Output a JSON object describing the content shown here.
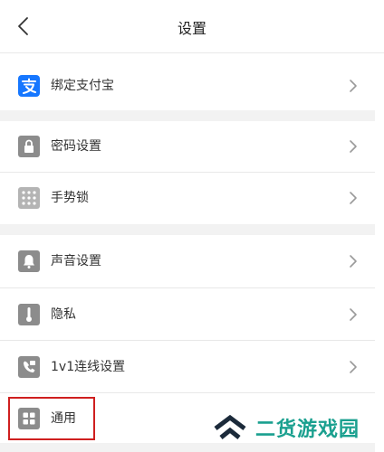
{
  "header": {
    "title": "设置"
  },
  "sections": [
    {
      "items": [
        {
          "label": "绑定支付宝",
          "icon": "alipay-icon"
        }
      ]
    },
    {
      "items": [
        {
          "label": "密码设置",
          "icon": "lock-icon"
        },
        {
          "label": "手势锁",
          "icon": "gesture-grid-icon"
        }
      ]
    },
    {
      "items": [
        {
          "label": "声音设置",
          "icon": "bell-icon"
        },
        {
          "label": "隐私",
          "icon": "thermometer-icon"
        },
        {
          "label": "1v1连线设置",
          "icon": "video-call-icon"
        },
        {
          "label": "通用",
          "icon": "grid-icon"
        }
      ]
    }
  ],
  "watermark": {
    "text": "二货游戏园",
    "logo": "chevron-up-double-icon"
  },
  "colors": {
    "alipay": "#1677ff",
    "icon_gray": "#8c8c8c",
    "highlight": "#cf1f1f",
    "watermark": "#1aa08f"
  }
}
